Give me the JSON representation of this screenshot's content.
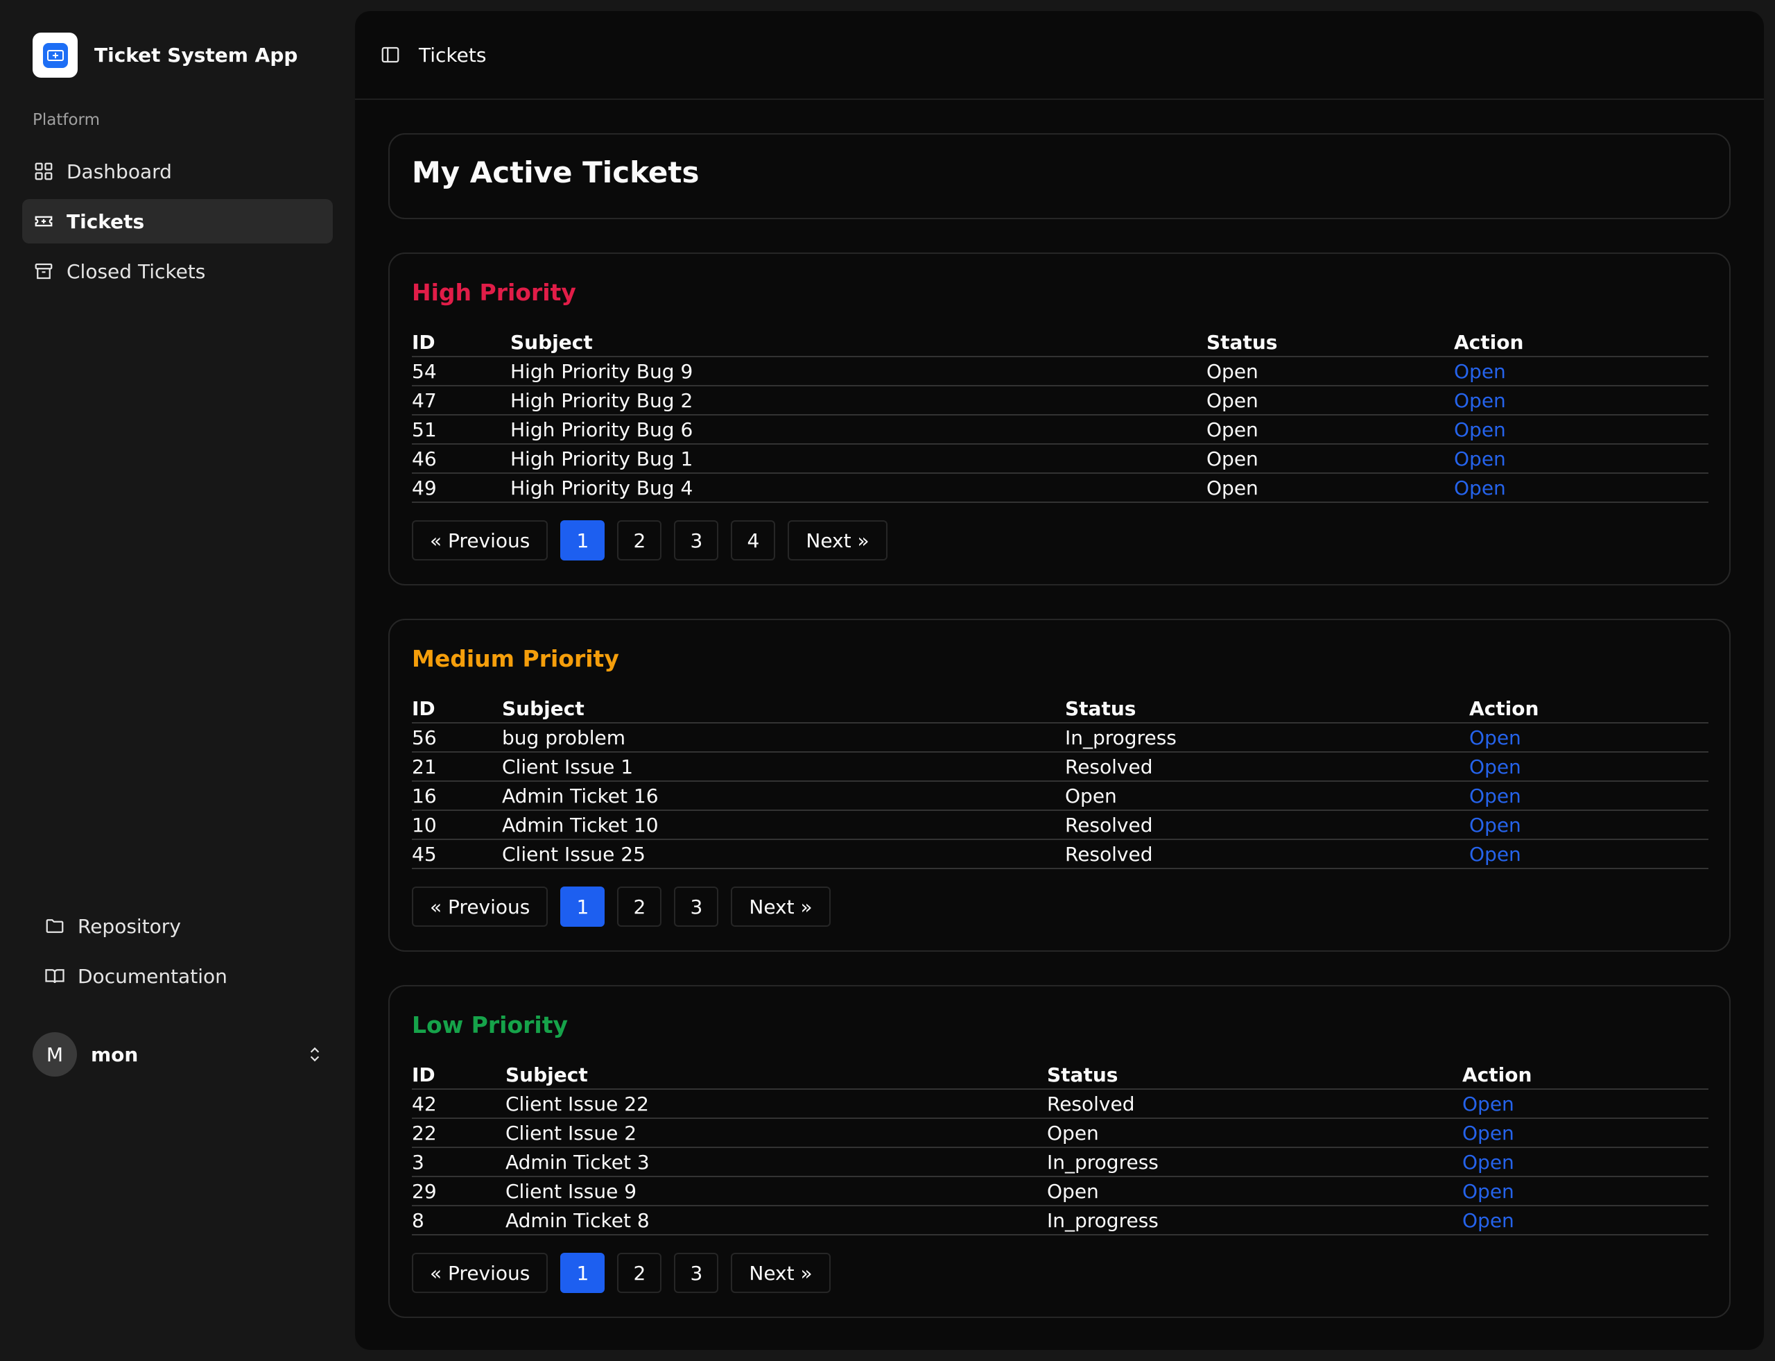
{
  "app": {
    "title": "Ticket System App"
  },
  "sidebar": {
    "group_label": "Platform",
    "nav": [
      {
        "label": "Dashboard",
        "icon": "grid-icon"
      },
      {
        "label": "Tickets",
        "icon": "ticket-icon",
        "active": true
      },
      {
        "label": "Closed Tickets",
        "icon": "archive-icon"
      }
    ],
    "secondary": [
      {
        "label": "Repository",
        "icon": "folder-icon"
      },
      {
        "label": "Documentation",
        "icon": "book-icon"
      }
    ],
    "user": {
      "initial": "M",
      "name": "mon"
    }
  },
  "header": {
    "title": "Tickets"
  },
  "page": {
    "heading": "My Active Tickets"
  },
  "columns": {
    "id": "ID",
    "subject": "Subject",
    "status": "Status",
    "action": "Action"
  },
  "sections": [
    {
      "title": "High Priority",
      "color": "#e11d48",
      "rows": [
        {
          "id": "54",
          "subject": "High Priority Bug 9",
          "status": "Open",
          "action": "Open"
        },
        {
          "id": "47",
          "subject": "High Priority Bug 2",
          "status": "Open",
          "action": "Open"
        },
        {
          "id": "51",
          "subject": "High Priority Bug 6",
          "status": "Open",
          "action": "Open"
        },
        {
          "id": "46",
          "subject": "High Priority Bug 1",
          "status": "Open",
          "action": "Open"
        },
        {
          "id": "49",
          "subject": "High Priority Bug 4",
          "status": "Open",
          "action": "Open"
        }
      ],
      "pagination": {
        "previous": "« Previous",
        "pages": [
          "1",
          "2",
          "3",
          "4"
        ],
        "current": "1",
        "next": "Next »"
      }
    },
    {
      "title": "Medium Priority",
      "color": "#f59e0b",
      "rows": [
        {
          "id": "56",
          "subject": "bug problem",
          "status": "In_progress",
          "action": "Open"
        },
        {
          "id": "21",
          "subject": "Client Issue 1",
          "status": "Resolved",
          "action": "Open"
        },
        {
          "id": "16",
          "subject": "Admin Ticket 16",
          "status": "Open",
          "action": "Open"
        },
        {
          "id": "10",
          "subject": "Admin Ticket 10",
          "status": "Resolved",
          "action": "Open"
        },
        {
          "id": "45",
          "subject": "Client Issue 25",
          "status": "Resolved",
          "action": "Open"
        }
      ],
      "pagination": {
        "previous": "« Previous",
        "pages": [
          "1",
          "2",
          "3"
        ],
        "current": "1",
        "next": "Next »"
      }
    },
    {
      "title": "Low Priority",
      "color": "#16a34a",
      "rows": [
        {
          "id": "42",
          "subject": "Client Issue 22",
          "status": "Resolved",
          "action": "Open"
        },
        {
          "id": "22",
          "subject": "Client Issue 2",
          "status": "Open",
          "action": "Open"
        },
        {
          "id": "3",
          "subject": "Admin Ticket 3",
          "status": "In_progress",
          "action": "Open"
        },
        {
          "id": "29",
          "subject": "Client Issue 9",
          "status": "Open",
          "action": "Open"
        },
        {
          "id": "8",
          "subject": "Admin Ticket 8",
          "status": "In_progress",
          "action": "Open"
        }
      ],
      "pagination": {
        "previous": "« Previous",
        "pages": [
          "1",
          "2",
          "3"
        ],
        "current": "1",
        "next": "Next »"
      }
    }
  ],
  "theme": {
    "accent": "#1d5ff0",
    "link": "#2563eb"
  }
}
